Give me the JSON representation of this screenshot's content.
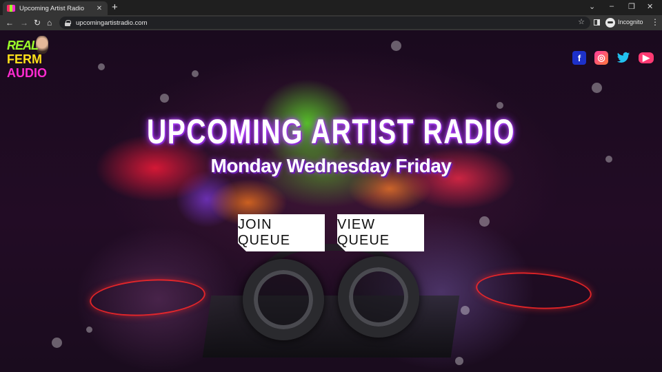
{
  "browser": {
    "tab_title": "Upcoming Artist Radio",
    "tab_close": "✕",
    "new_tab": "+",
    "url": "upcomingartistradio.com",
    "profile_label": "Incognito",
    "window_controls": {
      "minimize": "–",
      "restore": "❐",
      "close": "✕"
    },
    "nav": {
      "back": "←",
      "forward": "→",
      "reload": "↻",
      "home": "⌂"
    },
    "tab_search": "⌄",
    "star": "☆",
    "menu": "⋮"
  },
  "site": {
    "logo": {
      "line1": "REAL",
      "line2": "FERM",
      "line3": "AUDIO"
    },
    "social": [
      {
        "name": "facebook",
        "glyph": "f"
      },
      {
        "name": "instagram",
        "glyph": "◎"
      },
      {
        "name": "twitter",
        "glyph": "🐦"
      },
      {
        "name": "youtube",
        "glyph": "▶"
      }
    ],
    "hero": {
      "title": "UPCOMING ARTIST RADIO",
      "subtitle": "Monday Wednesday Friday"
    },
    "buttons": {
      "join": "JOIN QUEUE",
      "view": "VIEW QUEUE"
    }
  },
  "colors": {
    "logo_green": "#9cff2a",
    "logo_yellow": "#ffe01a",
    "logo_pink": "#ff2bd0",
    "title_glow": "#9b2cff",
    "button_bg": "#ffffff"
  }
}
